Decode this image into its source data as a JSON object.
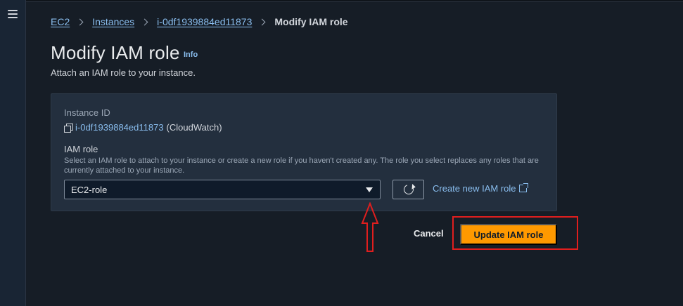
{
  "breadcrumb": {
    "items": [
      "EC2",
      "Instances",
      "i-0df1939884ed11873"
    ],
    "current": "Modify IAM role"
  },
  "page": {
    "title": "Modify IAM role",
    "info_label": "Info",
    "description": "Attach an IAM role to your instance."
  },
  "instance": {
    "label": "Instance ID",
    "id": "i-0df1939884ed11873",
    "name": "(CloudWatch)"
  },
  "iam": {
    "label": "IAM role",
    "help": "Select an IAM role to attach to your instance or create a new role if you haven't created any. The role you select replaces any roles that are currently attached to your instance.",
    "selected": "EC2-role",
    "create_link": "Create new IAM role"
  },
  "actions": {
    "cancel": "Cancel",
    "update": "Update IAM role"
  },
  "colors": {
    "background": "#161d26",
    "panel": "#232f3e",
    "link": "#89bdee",
    "primary": "#ff9900",
    "annotation": "#e01e1e"
  },
  "icons": [
    "menu-icon",
    "chevron-right-icon",
    "copy-icon",
    "caret-down-icon",
    "refresh-icon",
    "external-link-icon",
    "arrow-up-annotation"
  ]
}
